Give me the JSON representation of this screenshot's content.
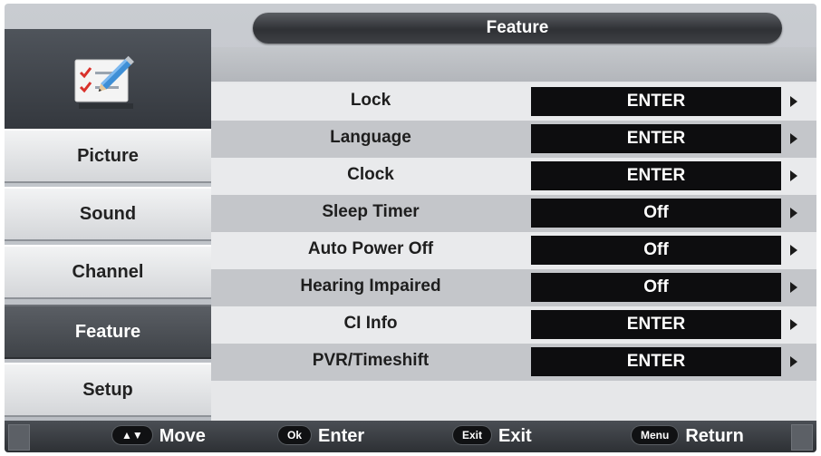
{
  "header": {
    "title": "Feature"
  },
  "sidebar": {
    "icon": "checklist-pencil-icon",
    "items": [
      {
        "label": "Picture",
        "active": false
      },
      {
        "label": "Sound",
        "active": false
      },
      {
        "label": "Channel",
        "active": false
      },
      {
        "label": "Feature",
        "active": true
      },
      {
        "label": "Setup",
        "active": false
      }
    ]
  },
  "menu": {
    "rows": [
      {
        "label": "Lock",
        "value": "ENTER"
      },
      {
        "label": "Language",
        "value": "ENTER"
      },
      {
        "label": "Clock",
        "value": "ENTER"
      },
      {
        "label": "Sleep Timer",
        "value": "Off"
      },
      {
        "label": "Auto Power Off",
        "value": "Off"
      },
      {
        "label": "Hearing Impaired",
        "value": "Off"
      },
      {
        "label": "CI Info",
        "value": "ENTER"
      },
      {
        "label": "PVR/Timeshift",
        "value": "ENTER"
      }
    ],
    "arrow_icon": "triangle-right-icon"
  },
  "help": {
    "move": {
      "key": "▲▼",
      "label": "Move"
    },
    "enter": {
      "key": "Ok",
      "label": "Enter"
    },
    "exit": {
      "key": "Exit",
      "label": "Exit"
    },
    "return": {
      "key": "Menu",
      "label": "Return"
    }
  }
}
